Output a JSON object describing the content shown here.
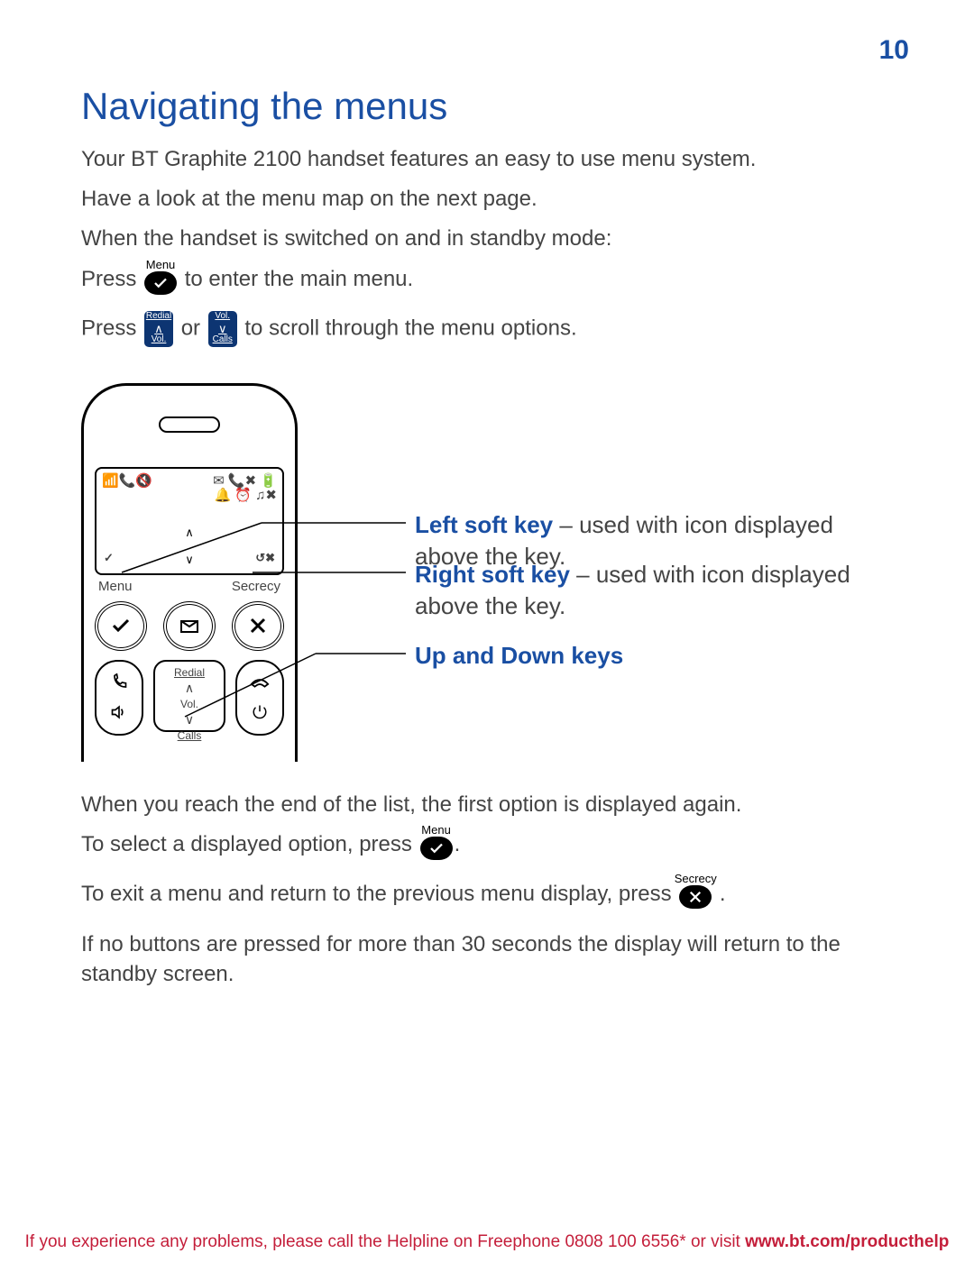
{
  "page_number": "10",
  "headings": {
    "title": "Navigating the menus"
  },
  "paragraphs": {
    "intro": "Your BT Graphite 2100 handset features an easy to use menu system.",
    "look_map": "Have a look at the menu map on the next page.",
    "standby": "When the handset is switched on and in standby mode:",
    "press_enter_before": "Press",
    "press_enter_after": "to enter the main menu.",
    "press_scroll_before": "Press",
    "press_scroll_mid": "or",
    "press_scroll_after": "to scroll through the menu options.",
    "end_list": "When you reach the end of the list, the first option is displayed again.",
    "to_select_before": "To select a displayed option, press",
    "to_select_after": ".",
    "to_exit_before": "To exit a menu and return to the previous menu display, press",
    "to_exit_after": " .",
    "timeout": "If no buttons are pressed for more than 30 seconds the display will return to the standby screen."
  },
  "buttons": {
    "menu_label": "Menu",
    "secrecy_label": "Secrecy",
    "up_key": {
      "top": "Redial",
      "bottom": "Vol."
    },
    "down_key": {
      "top": "Vol.",
      "bottom": "Calls"
    }
  },
  "callouts": {
    "left_soft_lead": "Left soft key",
    "left_soft_rest": " – used with icon displayed above the key.",
    "right_soft_lead": "Right soft key",
    "right_soft_rest": " – used with icon displayed above the key.",
    "updown_lead": "Up and Down keys"
  },
  "handset": {
    "screen": {
      "left_icons": "📶📞🔇",
      "right_top": "✉ 📞✖ 🔋",
      "right_bottom": "🔔 ⏰ ♫✖",
      "bottom_left": "✓",
      "bottom_right": "↺✖"
    },
    "soft_labels": {
      "left": "Menu",
      "right": "Secrecy"
    },
    "center_key": {
      "top": "Redial",
      "mid": "Vol.",
      "bottom": "Calls"
    }
  },
  "footer": {
    "text": "If you experience any problems, please call the Helpline on Freephone 0808 100 6556* or visit ",
    "bold": "www.bt.com/producthelp"
  }
}
